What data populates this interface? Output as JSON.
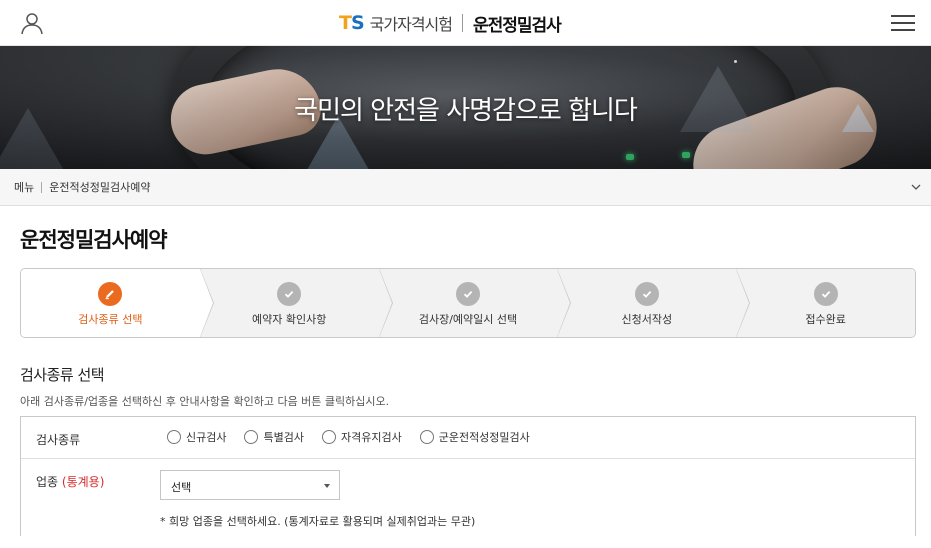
{
  "header": {
    "logo_t": "T",
    "logo_s": "S",
    "brand_sub": "국가자격시험",
    "brand_main": "운전정밀검사"
  },
  "banner": {
    "slogan": "국민의 안전을 사명감으로 합니다"
  },
  "breadcrumb": {
    "root": "메뉴",
    "current": "운전적성정밀검사예약"
  },
  "page": {
    "title": "운전정밀검사예약"
  },
  "steps": [
    {
      "label": "검사종류 선택",
      "state": "active",
      "icon": "pencil-icon"
    },
    {
      "label": "예약자 확인사항",
      "state": "pending",
      "icon": "check-icon"
    },
    {
      "label": "검사장/예약일시 선택",
      "state": "pending",
      "icon": "check-icon"
    },
    {
      "label": "신청서작성",
      "state": "pending",
      "icon": "check-icon"
    },
    {
      "label": "접수완료",
      "state": "pending",
      "icon": "check-icon"
    }
  ],
  "section": {
    "title": "검사종류 선택",
    "description": "아래 검사종류/업종을 선택하신 후 안내사항을 확인하고 다음 버튼 클릭하십시오."
  },
  "form": {
    "exam_type": {
      "label": "검사종류",
      "options": [
        "신규검사",
        "특별검사",
        "자격유지검사",
        "군운전적성정밀검사"
      ]
    },
    "industry": {
      "label": "업종",
      "label_note": "(통계용)",
      "selected": "선택",
      "hint": "* 희망 업종을 선택하세요. (통계자료로 활용되며 실제취업과는 무관)"
    }
  },
  "colors": {
    "accent_orange": "#ea6a1f",
    "active_text": "#e05d13",
    "step_inactive": "#b4b4b4",
    "note_red": "#d62b2b",
    "logo_t": "#f2a21b",
    "logo_s": "#1a6fc2"
  }
}
